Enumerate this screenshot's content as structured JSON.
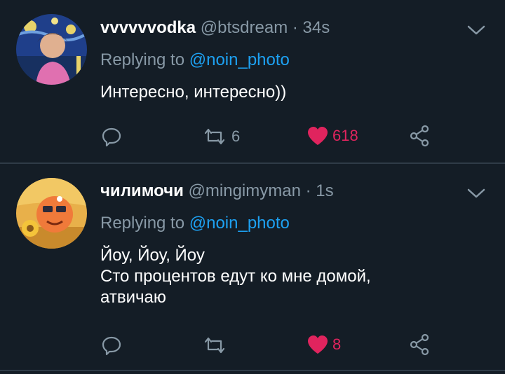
{
  "tweets": [
    {
      "display_name": "vvvvvvodka",
      "handle": "@btsdream",
      "time": "· 34s",
      "replying_prefix": "Replying to",
      "replying_to": "@noin_photo",
      "text": "Интересно, интересно))",
      "retweets": "6",
      "likes": "618",
      "icons": [
        "chevron-down-icon",
        "reply-icon",
        "retweet-icon",
        "heart-icon",
        "share-icon"
      ]
    },
    {
      "display_name": "чилимочи",
      "handle": "@mingimyman",
      "time": "· 1s",
      "replying_prefix": "Replying to",
      "replying_to": "@noin_photo",
      "text_line1": "Йоу, Йоу, Йоу",
      "text_line2": "Сто процентов едут ко мне домой,",
      "text_line3": "атвичаю",
      "retweets": "",
      "likes": "8",
      "icons": [
        "chevron-down-icon",
        "reply-icon",
        "retweet-icon",
        "heart-icon",
        "share-icon"
      ]
    }
  ],
  "colors": {
    "background": "#141d26",
    "muted": "#8899a6",
    "link": "#1da1f2",
    "like": "#e0245e",
    "divider": "#2f3b47"
  }
}
